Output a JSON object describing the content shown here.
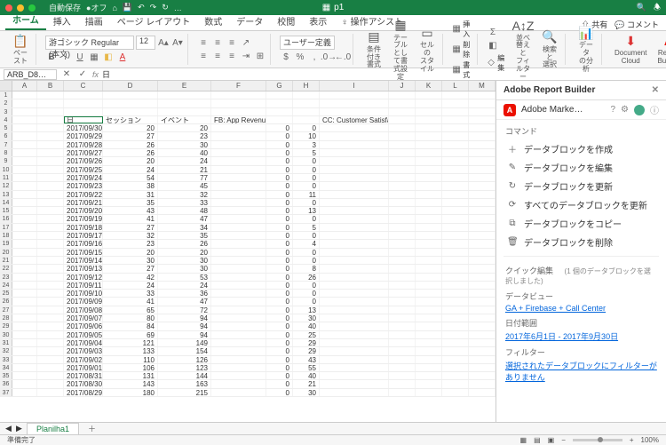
{
  "titlebar": {
    "autosave_label": "自動保存",
    "autosave_state": "●オフ",
    "filename": "p1",
    "qat_icons": [
      "home",
      "save",
      "undo",
      "redo",
      "sync",
      "more"
    ]
  },
  "tabs": {
    "items": [
      "ホーム",
      "挿入",
      "描画",
      "ページ レイアウト",
      "数式",
      "データ",
      "校閲",
      "表示",
      "操作アシスト"
    ],
    "active_index": 0,
    "share": "共有",
    "comments": "コメント"
  },
  "ribbon": {
    "paste": "ペースト",
    "font_name": "游ゴシック Regular (本文)",
    "font_size": "12",
    "number_format": "ユーザー定義",
    "cond_fmt": "条件付き\n書式",
    "as_table": "テーブルとし\nて書式設定",
    "cell_styles": "セルの\nスタイル",
    "insert": "挿入",
    "delete": "削除",
    "format": "書式",
    "edit": "編集",
    "sort_filter": "並べ替えと\nフィルター",
    "find_select": "検索と\n選択",
    "analyze": "データ\nの分析",
    "doc_cloud": "Document\nCloud",
    "report_builder": "Report\nBuilder"
  },
  "formula_bar": {
    "name_box": "ARB_D8…",
    "value": "日"
  },
  "columns": [
    "A",
    "B",
    "C",
    "D",
    "E",
    "F",
    "G",
    "H",
    "I",
    "J",
    "K",
    "L",
    "M"
  ],
  "headers": {
    "C": "日",
    "D": "セッション",
    "E": "イベント",
    "F": "FB: App Revenue",
    "I": "CC: Customer Satisfaction Rating"
  },
  "chart_data": {
    "type": "table",
    "columns": [
      "日",
      "セッション",
      "イベント",
      "FB: App Revenue",
      "(blank G)",
      "(blank H)",
      "CC: Customer Satisfaction Rating"
    ],
    "rows": [
      [
        "2017/09/30",
        20,
        20,
        "",
        0,
        0,
        ""
      ],
      [
        "2017/09/29",
        27,
        23,
        "",
        0,
        10,
        ""
      ],
      [
        "2017/09/28",
        26,
        30,
        "",
        0,
        3,
        ""
      ],
      [
        "2017/09/27",
        26,
        40,
        "",
        0,
        5,
        ""
      ],
      [
        "2017/09/26",
        20,
        24,
        "",
        0,
        0,
        ""
      ],
      [
        "2017/09/25",
        24,
        21,
        "",
        0,
        0,
        ""
      ],
      [
        "2017/09/24",
        54,
        77,
        "",
        0,
        0,
        ""
      ],
      [
        "2017/09/23",
        38,
        45,
        "",
        0,
        0,
        ""
      ],
      [
        "2017/09/22",
        31,
        32,
        "",
        0,
        11,
        ""
      ],
      [
        "2017/09/21",
        35,
        33,
        "",
        0,
        0,
        ""
      ],
      [
        "2017/09/20",
        43,
        48,
        "",
        0,
        13,
        ""
      ],
      [
        "2017/09/19",
        41,
        47,
        "",
        0,
        0,
        ""
      ],
      [
        "2017/09/18",
        27,
        34,
        "",
        0,
        5,
        ""
      ],
      [
        "2017/09/17",
        32,
        35,
        "",
        0,
        0,
        ""
      ],
      [
        "2017/09/16",
        23,
        26,
        "",
        0,
        4,
        ""
      ],
      [
        "2017/09/15",
        20,
        20,
        "",
        0,
        0,
        ""
      ],
      [
        "2017/09/14",
        30,
        30,
        "",
        0,
        0,
        ""
      ],
      [
        "2017/09/13",
        27,
        30,
        "",
        0,
        8,
        ""
      ],
      [
        "2017/09/12",
        42,
        53,
        "",
        0,
        26,
        ""
      ],
      [
        "2017/09/11",
        24,
        24,
        "",
        0,
        0,
        ""
      ],
      [
        "2017/09/10",
        33,
        36,
        "",
        0,
        0,
        ""
      ],
      [
        "2017/09/09",
        41,
        47,
        "",
        0,
        0,
        ""
      ],
      [
        "2017/09/08",
        65,
        72,
        "",
        0,
        13,
        ""
      ],
      [
        "2017/09/07",
        80,
        94,
        "",
        0,
        30,
        ""
      ],
      [
        "2017/09/06",
        84,
        94,
        "",
        0,
        40,
        ""
      ],
      [
        "2017/09/05",
        69,
        94,
        "",
        0,
        25,
        ""
      ],
      [
        "2017/09/04",
        121,
        149,
        "",
        0,
        29,
        ""
      ],
      [
        "2017/09/03",
        133,
        154,
        "",
        0,
        29,
        ""
      ],
      [
        "2017/09/02",
        110,
        126,
        "",
        0,
        43,
        ""
      ],
      [
        "2017/09/01",
        106,
        123,
        "",
        0,
        55,
        ""
      ],
      [
        "2017/08/31",
        131,
        144,
        "",
        0,
        40,
        ""
      ],
      [
        "2017/08/30",
        143,
        163,
        "",
        0,
        21,
        ""
      ],
      [
        "2017/08/29",
        180,
        215,
        "",
        0,
        30,
        ""
      ]
    ]
  },
  "panel": {
    "title": "Adobe Report Builder",
    "brand": "Adobe Marke…",
    "section_commands": "コマンド",
    "cmd_create": "データブロックを作成",
    "cmd_edit": "データブロックを編集",
    "cmd_refresh": "データブロックを更新",
    "cmd_refresh_all": "すべてのデータブロックを更新",
    "cmd_copy": "データブロックをコピー",
    "cmd_delete": "データブロックを削除",
    "quick_edit_label": "クイック編集",
    "quick_edit_note": "(1 個のデータブロックを選択しました)",
    "data_view_label": "データビュー",
    "data_view_value": "GA + Firebase + Call Center",
    "date_range_label": "日付範囲",
    "date_range_value": "2017年6月1日 - 2017年9月30日",
    "filter_label": "フィルター",
    "filter_value": "選択されたデータブロックにフィルターがありません"
  },
  "sheets": {
    "active": "Planilha1"
  },
  "statusbar": {
    "ready": "準備完了",
    "zoom": "100%"
  },
  "icons": {
    "pencil": "✎",
    "plus": "＋",
    "refresh": "↻",
    "refresh_all": "⟳",
    "copy": "⧉",
    "trash": "🗑",
    "share": "⇧",
    "comment": "💬",
    "close": "✕",
    "help": "?",
    "gear": "⚙",
    "info": "ⓘ",
    "ellipsis": "…",
    "search": "🔍",
    "adobe": "A",
    "xl": "▦"
  }
}
